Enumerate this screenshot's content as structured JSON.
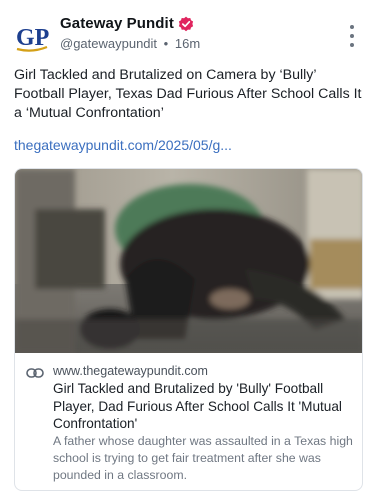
{
  "post": {
    "author": {
      "name": "Gateway Pundit",
      "handle": "@gatewaypundit",
      "separator": "•",
      "time": "16m",
      "avatar_text": "GP",
      "verified_icon": "verified-badge-icon",
      "brand_color": "#1d3f8f",
      "verified_color": "#e0245e"
    },
    "text": "Girl Tackled and Brutalized on Camera by ‘Bully’ Football Player, Texas Dad Furious After School Calls It a ‘Mutual Confrontation’",
    "link_text": "thegatewaypundit.com/2025/05/g...",
    "more_icon": "more-vertical-icon"
  },
  "link_card": {
    "link_icon": "link-icon",
    "domain": "www.thegatewaypundit.com",
    "title": "Girl Tackled and Brutalized by 'Bully' Football Player, Dad Furious After School Calls It 'Mutual Confrontation'",
    "description": "A father whose daughter was assaulted in a Texas high school is trying to get fair treatment after she was pounded in a classroom."
  }
}
